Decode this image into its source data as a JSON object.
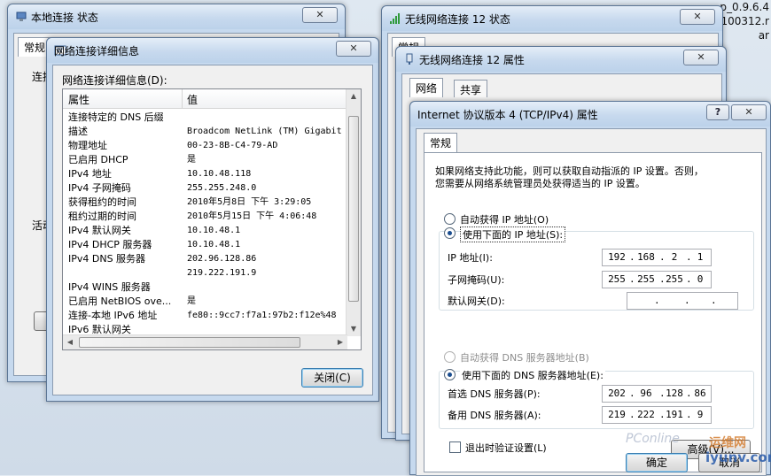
{
  "corner": {
    "line1": "p_0.9.6.4",
    "line2": "100312.r",
    "line3": "ar"
  },
  "win_status": {
    "title": "本地连接 状态",
    "tab": "常规",
    "left_label_1": "连接",
    "left_label_2": "活动",
    "close_x": "✕"
  },
  "win_details": {
    "title": "网络连接详细信息",
    "close_x": "✕",
    "caption": "网络连接详细信息(D):",
    "col_prop": "属性",
    "col_val": "值",
    "rows": [
      {
        "k": "连接特定的 DNS 后缀",
        "v": ""
      },
      {
        "k": "描述",
        "v": "Broadcom NetLink (TM) Gigabit"
      },
      {
        "k": "物理地址",
        "v": "00-23-8B-C4-79-AD"
      },
      {
        "k": "已启用 DHCP",
        "v": "是"
      },
      {
        "k": "IPv4 地址",
        "v": "10.10.48.118"
      },
      {
        "k": "IPv4 子网掩码",
        "v": "255.255.248.0"
      },
      {
        "k": "获得租约的时间",
        "v": "2010年5月8日 下午 3:29:05"
      },
      {
        "k": "租约过期的时间",
        "v": "2010年5月15日 下午 4:06:48"
      },
      {
        "k": "IPv4 默认网关",
        "v": "10.10.48.1"
      },
      {
        "k": "IPv4 DHCP 服务器",
        "v": "10.10.48.1"
      },
      {
        "k": "IPv4 DNS 服务器",
        "v": "202.96.128.86"
      },
      {
        "k": "",
        "v": "219.222.191.9"
      },
      {
        "k": "IPv4 WINS 服务器",
        "v": ""
      },
      {
        "k": "已启用 NetBIOS ove...",
        "v": "是"
      },
      {
        "k": "连接-本地 IPv6 地址",
        "v": "fe80::9cc7:f7a1:97b2:f12e%48"
      },
      {
        "k": "IPv6 默认网关",
        "v": ""
      }
    ],
    "close_btn": "关闭(C)"
  },
  "win_wifi_status": {
    "title": "无线网络连接 12 状态",
    "close_x": "✕",
    "tab": "常规"
  },
  "win_wifi_props": {
    "title": "无线网络连接 12 属性",
    "close_x": "✕",
    "tab_net": "网络",
    "tab_share": "共享"
  },
  "win_tcpip": {
    "title": "Internet 协议版本 4 (TCP/IPv4) 属性",
    "help": "?",
    "close_x": "✕",
    "tab": "常规",
    "desc_line1": "如果网络支持此功能，则可以获取自动指派的 IP 设置。否则，",
    "desc_line2": "您需要从网络系统管理员处获得适当的 IP 设置。",
    "auto_ip": "自动获得 IP 地址(O)",
    "manual_ip": "使用下面的 IP 地址(S):",
    "ip_label": "IP 地址(I):",
    "ip_value": [
      "192",
      "168",
      "2",
      "1"
    ],
    "mask_label": "子网掩码(U):",
    "mask_value": [
      "255",
      "255",
      "255",
      "0"
    ],
    "gw_label": "默认网关(D):",
    "gw_value": [
      "",
      "",
      "",
      ""
    ],
    "auto_dns": "自动获得 DNS 服务器地址(B)",
    "manual_dns": "使用下面的 DNS 服务器地址(E):",
    "dns1_label": "首选 DNS 服务器(P):",
    "dns1_value": [
      "202",
      "96",
      "128",
      "86"
    ],
    "dns2_label": "备用 DNS 服务器(A):",
    "dns2_value": [
      "219",
      "222",
      "191",
      "9"
    ],
    "validate": "退出时验证设置(L)",
    "advanced": "高级(V)...",
    "ok": "确定",
    "cancel": "取消"
  },
  "watermark": {
    "left": "PConline",
    "right_cn": "运维网",
    "right_url": "iyunv.com"
  }
}
